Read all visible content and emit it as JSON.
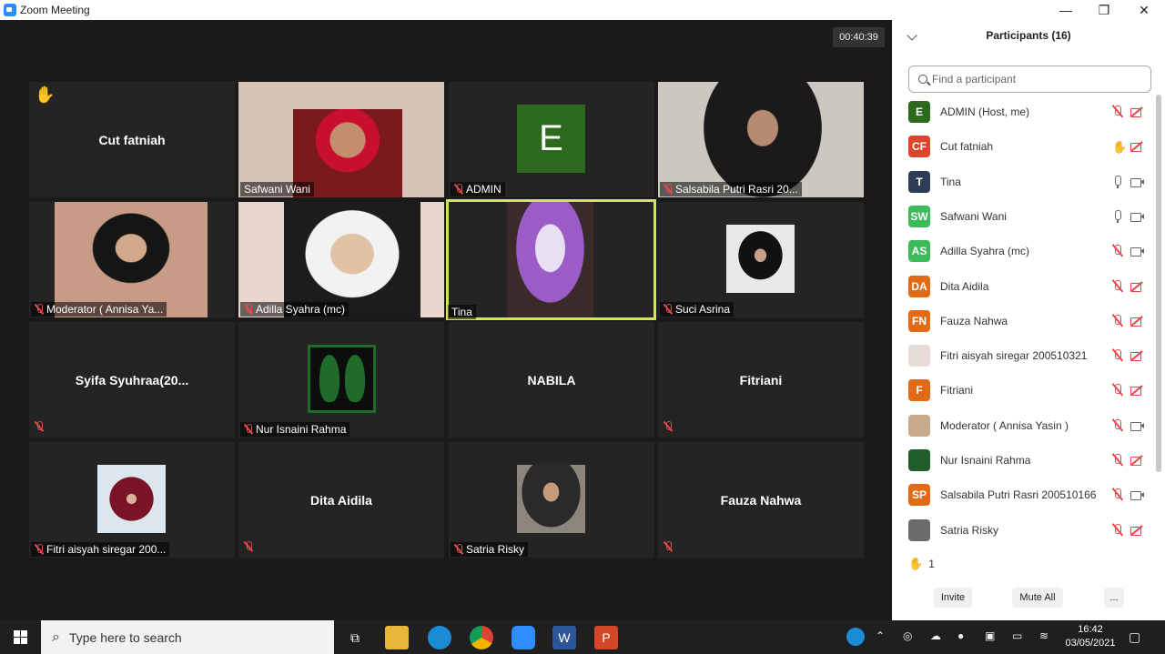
{
  "window": {
    "title": "Zoom Meeting",
    "minimize": "—",
    "maximize": "❐",
    "close": "✕"
  },
  "timer": "00:40:39",
  "tiles": {
    "cut_fatniah": {
      "name": "Cut fatniah"
    },
    "safwani": {
      "label": "Safwani Wani"
    },
    "admin": {
      "avatar": "E",
      "label": "ADMIN"
    },
    "salsabila": {
      "label": "Salsabila Putri Rasri 20..."
    },
    "moderator": {
      "label": "Moderator ( Annisa Ya..."
    },
    "adilla": {
      "label": "Adilla Syahra (mc)"
    },
    "tina": {
      "label": "Tina"
    },
    "suci": {
      "label": "Suci Asrina"
    },
    "syifa": {
      "name": "Syifa  Syuhraa(20..."
    },
    "nur": {
      "label": "Nur Isnaini Rahma"
    },
    "nabila": {
      "name": "NABILA"
    },
    "fitriani": {
      "name": "Fitriani"
    },
    "fitri": {
      "label": "Fitri aisyah siregar 200..."
    },
    "dita": {
      "name": "Dita Aidila"
    },
    "satria": {
      "label": "Satria Risky"
    },
    "fauza": {
      "name": "Fauza Nahwa"
    }
  },
  "sidebar": {
    "title": "Participants (16)",
    "search_placeholder": "Find a participant",
    "participants": [
      {
        "initials": "E",
        "name": "ADMIN (Host, me)",
        "color": "#2e6a1e",
        "mic": "muted",
        "cam": "off"
      },
      {
        "initials": "CF",
        "name": "Cut fatniah",
        "color": "#d9462b",
        "mic": "hand",
        "cam": "off"
      },
      {
        "initials": "T",
        "name": "Tina",
        "color": "#2b3e55",
        "mic": "on",
        "cam": "on"
      },
      {
        "initials": "SW",
        "name": "Safwani Wani",
        "color": "#3dbb5a",
        "mic": "on",
        "cam": "on"
      },
      {
        "initials": "AS",
        "name": "Adilla Syahra (mc)",
        "color": "#3dbb5a",
        "mic": "muted",
        "cam": "on"
      },
      {
        "initials": "DA",
        "name": "Dita Aidila",
        "color": "#e06a15",
        "mic": "muted",
        "cam": "off"
      },
      {
        "initials": "FN",
        "name": "Fauza Nahwa",
        "color": "#e06a15",
        "mic": "muted",
        "cam": "off"
      },
      {
        "initials": "",
        "name": "Fitri aisyah siregar 200510321",
        "color": "#e8dcd8",
        "mic": "muted",
        "cam": "off"
      },
      {
        "initials": "F",
        "name": "Fitriani",
        "color": "#e06a15",
        "mic": "muted",
        "cam": "off"
      },
      {
        "initials": "",
        "name": "Moderator ( Annisa Yasin )",
        "color": "#c9a98e",
        "mic": "muted",
        "cam": "on"
      },
      {
        "initials": "",
        "name": "Nur Isnaini Rahma",
        "color": "#1f5e2a",
        "mic": "muted",
        "cam": "off"
      },
      {
        "initials": "SP",
        "name": "Salsabila Putri Rasri 200510166",
        "color": "#e06a15",
        "mic": "muted",
        "cam": "on"
      },
      {
        "initials": "",
        "name": "Satria Risky",
        "color": "#6b6b6b",
        "mic": "muted",
        "cam": "off"
      }
    ],
    "raised_hands": "1",
    "invite": "Invite",
    "mute_all": "Mute All",
    "more": "..."
  },
  "taskbar": {
    "search_placeholder": "Type here to search",
    "time": "16:42",
    "date": "03/05/2021"
  }
}
